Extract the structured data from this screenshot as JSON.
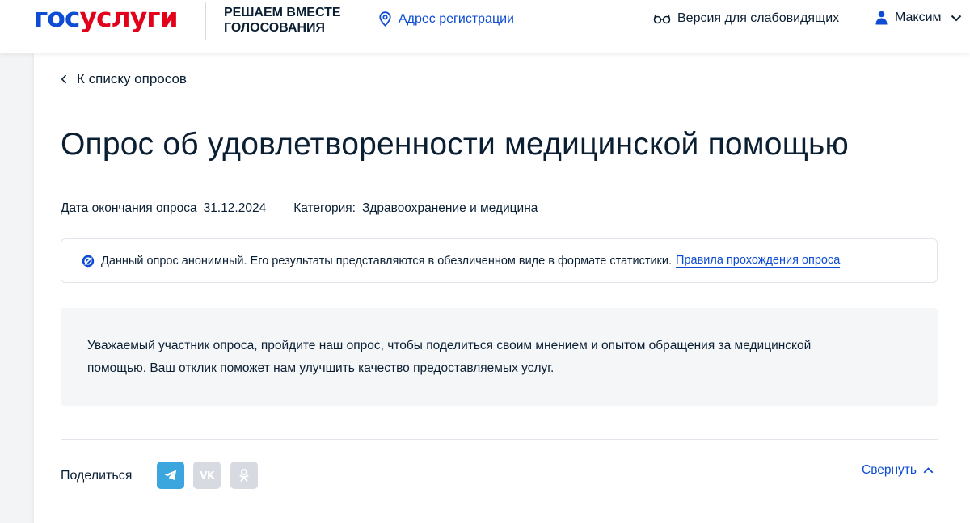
{
  "header": {
    "logo_part1": "гос",
    "logo_part2": "услуги",
    "tagline_line1": "РЕШАЕМ ВМЕСТЕ",
    "tagline_line2": "ГОЛОСОВАНИЯ",
    "address_label": "Адрес регистрации",
    "low_vision_label": "Версия для слабовидящих",
    "user_name": "Максим"
  },
  "nav": {
    "back_label": "К списку опросов"
  },
  "survey": {
    "title": "Опрос об удовлетворенности медицинской помощью",
    "end_date_label": "Дата окончания опроса",
    "end_date_value": "31.12.2024",
    "category_label": "Категория:",
    "category_value": "Здравоохранение и медицина",
    "notice_text": "Данный опрос анонимный. Его результаты представляются в обезличенном виде в формате статистики.",
    "rules_link": "Правила прохождения опроса",
    "intro_line1": "Уважаемый участник опроса, пройдите наш опрос, чтобы поделиться своим мнением и опытом обращения за медицинской",
    "intro_line2": "помощью. Ваш отклик поможет нам улучшить качество предоставляемых услуг."
  },
  "share": {
    "label": "Поделиться",
    "vk_text": "VK",
    "buttons": [
      "telegram-icon",
      "vk-icon",
      "odnoklassniki-icon"
    ]
  },
  "collapse_label": "Свернуть",
  "colors": {
    "brand_blue": "#0d4cd3",
    "brand_red": "#e3001b",
    "text": "#0b1f33",
    "telegram": "#3aa6dd",
    "muted_icon_bg": "#d7dbe1"
  }
}
